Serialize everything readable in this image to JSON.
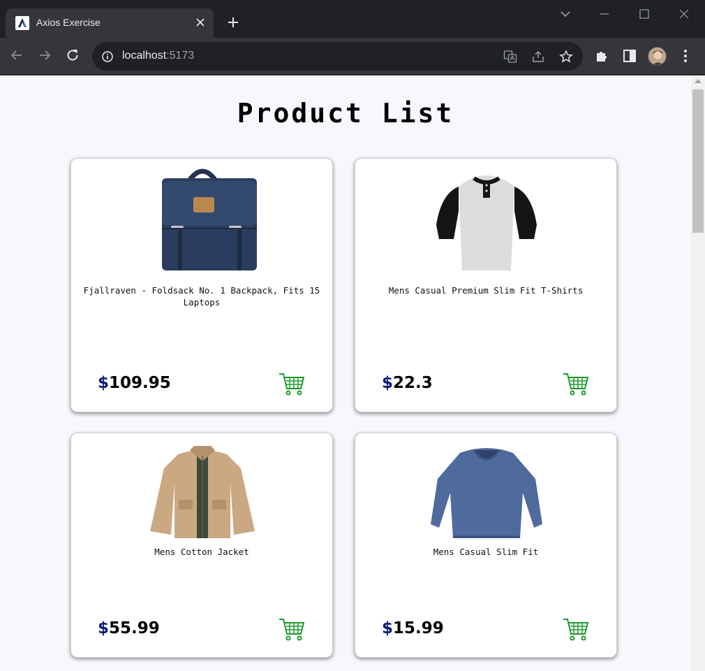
{
  "browser": {
    "tab_title": "Axios Exercise",
    "url_host": "localhost",
    "url_port": ":5173"
  },
  "page": {
    "title": "Product List"
  },
  "products": [
    {
      "name": "Fjallraven - Foldsack No. 1 Backpack, Fits 15 Laptops",
      "currency": "$",
      "price": "109.95",
      "image": "backpack"
    },
    {
      "name": "Mens Casual Premium Slim Fit T-Shirts",
      "currency": "$",
      "price": "22.3",
      "image": "t-shirt"
    },
    {
      "name": "Mens Cotton Jacket",
      "currency": "$",
      "price": "55.99",
      "image": "jacket"
    },
    {
      "name": "Mens Casual Slim Fit",
      "currency": "$",
      "price": "15.99",
      "image": "long-sleeve-shirt"
    }
  ],
  "colors": {
    "price_currency": "#0c1a78",
    "cart_icon": "#1f9a2e",
    "page_bg": "#f7f8fd"
  }
}
